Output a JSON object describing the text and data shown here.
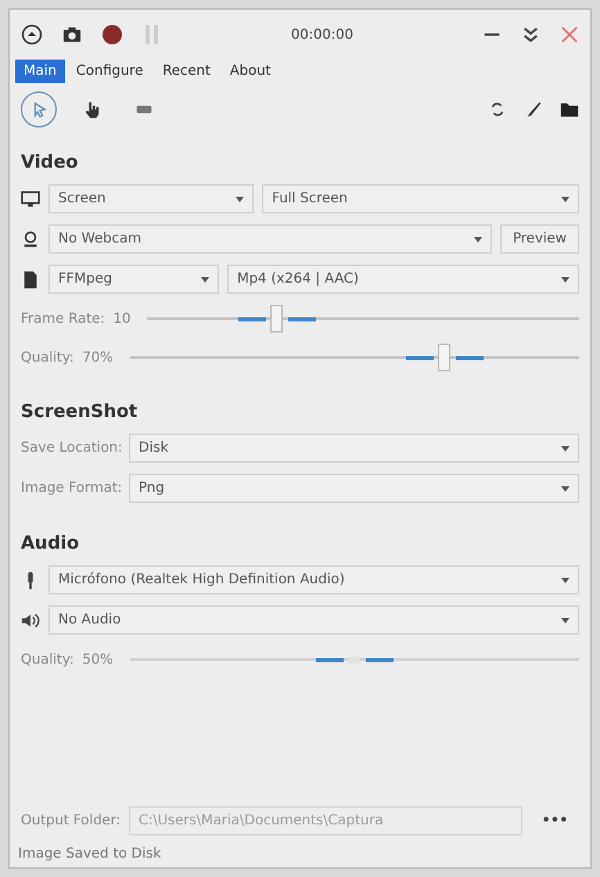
{
  "title_bar": {
    "timer": "00:00:00",
    "recording": false,
    "paused": false
  },
  "tabs": [
    {
      "label": "Main",
      "selected": true
    },
    {
      "label": "Configure",
      "selected": false
    },
    {
      "label": "Recent",
      "selected": false
    },
    {
      "label": "About",
      "selected": false
    }
  ],
  "tools": [
    {
      "kind": "pointer",
      "selected": true
    },
    {
      "kind": "hand",
      "selected": false
    },
    {
      "kind": "keyboard",
      "selected": false
    }
  ],
  "video": {
    "heading": "Video",
    "source": {
      "value": "Screen",
      "target": "Full Screen"
    },
    "webcam": {
      "value": "No Webcam",
      "button": "Preview"
    },
    "writer": {
      "value": "FFMpeg",
      "format": "Mp4 (x264 | AAC)"
    },
    "sliders": [
      {
        "label": "Frame Rate:",
        "reading": "10",
        "level": 0.3,
        "disabled": false
      },
      {
        "label": "Quality:",
        "reading": "70%",
        "level": 0.7,
        "disabled": false
      }
    ]
  },
  "screenshot": {
    "heading": "ScreenShot",
    "fields": [
      {
        "label": "Save Location:",
        "value": "Disk"
      },
      {
        "label": "Image Format:",
        "value": "Png"
      }
    ]
  },
  "audio": {
    "heading": "Audio",
    "devices": [
      {
        "kind": "microphone",
        "value": "Micrófono (Realtek High Definition Audio)"
      },
      {
        "kind": "speaker",
        "value": "No Audio"
      }
    ],
    "sliders": [
      {
        "label": "Quality:",
        "reading": "50%",
        "level": 0.5,
        "disabled": true
      }
    ]
  },
  "output": {
    "label": "Output Folder:",
    "placeholder": "C:\\Users\\Maria\\Documents\\Captura",
    "button": "•••"
  },
  "status_bar": "Image Saved to Disk"
}
